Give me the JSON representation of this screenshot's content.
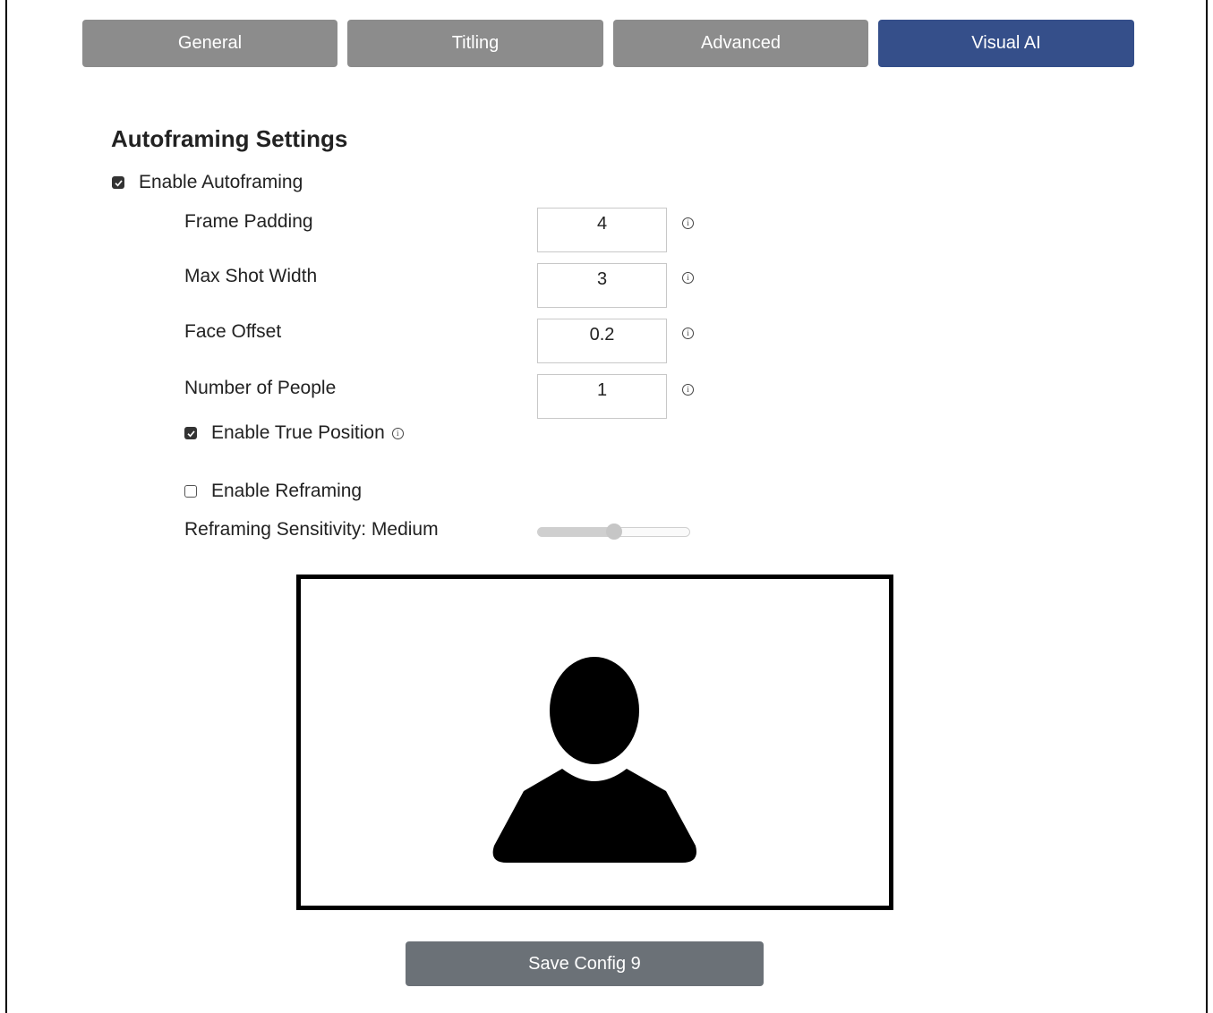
{
  "tabs": [
    {
      "label": "General",
      "active": false
    },
    {
      "label": "Titling",
      "active": false
    },
    {
      "label": "Advanced",
      "active": false
    },
    {
      "label": "Visual AI",
      "active": true
    }
  ],
  "section_title": "Autoframing Settings",
  "enable_autoframing": {
    "label": "Enable Autoframing",
    "checked": true
  },
  "fields": {
    "frame_padding": {
      "label": "Frame Padding",
      "value": "4"
    },
    "max_shot_width": {
      "label": "Max Shot Width",
      "value": "3"
    },
    "face_offset": {
      "label": "Face Offset",
      "value": "0.2"
    },
    "number_of_people": {
      "label": "Number of People",
      "value": "1"
    }
  },
  "enable_true_position": {
    "label": "Enable True Position",
    "checked": true
  },
  "enable_reframing": {
    "label": "Enable Reframing",
    "checked": false
  },
  "reframing_sensitivity": {
    "label": "Reframing Sensitivity: Medium",
    "level_fraction": 0.5
  },
  "icons": {
    "info": "info-icon",
    "preview": "person-silhouette-icon",
    "check": "checkmark-icon"
  },
  "colors": {
    "tab_active": "#354f8a",
    "tab_inactive": "#8c8c8c",
    "save_button": "#6b7177"
  },
  "save_button": {
    "label": "Save Config 9"
  }
}
